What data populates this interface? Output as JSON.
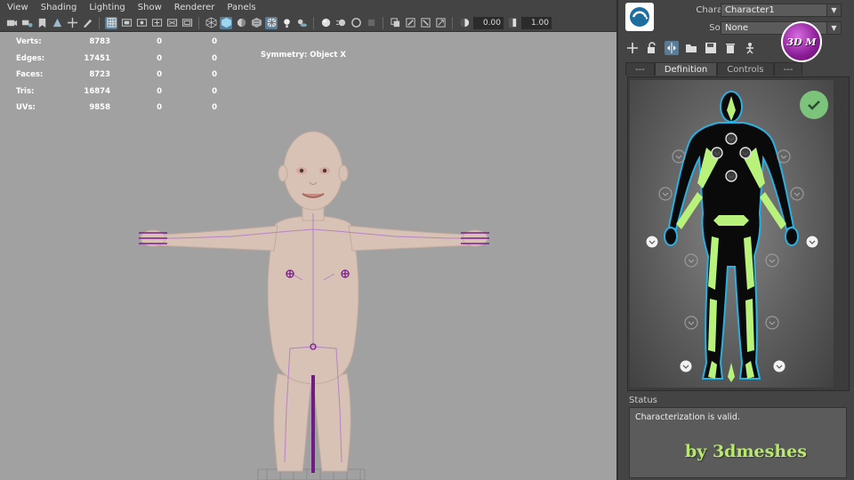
{
  "menubar": {
    "items": [
      "View",
      "Shading",
      "Lighting",
      "Show",
      "Renderer",
      "Panels"
    ]
  },
  "toolbar": {
    "value_a": "0.00",
    "value_b": "1.00",
    "icons": [
      "camera-icon",
      "camera-attr-icon",
      "bookmark-icon",
      "image-plane-icon",
      "grid-icon",
      "wireframe-icon",
      "smooth-shade-icon",
      "textured-icon",
      "lights-icon",
      "shadows-icon",
      "isolate-icon",
      "xray-icon",
      "xray-joints-icon",
      "resolution-gate-icon",
      "exposure-icon",
      "gamma-icon"
    ]
  },
  "hud": {
    "rows": [
      {
        "label": "Verts:",
        "v1": "8783",
        "v2": "0",
        "v3": "0"
      },
      {
        "label": "Edges:",
        "v1": "17451",
        "v2": "0",
        "v3": "0"
      },
      {
        "label": "Faces:",
        "v1": "8723",
        "v2": "0",
        "v3": "0"
      },
      {
        "label": "Tris:",
        "v1": "16874",
        "v2": "0",
        "v3": "0"
      },
      {
        "label": "UVs:",
        "v1": "9858",
        "v2": "0",
        "v3": "0"
      }
    ],
    "symmetry": "Symmetry: Object X"
  },
  "panel": {
    "character_label": "Character:",
    "character_value": "Character1",
    "source_label": "Source:",
    "source_value": "None",
    "tabs": [
      "---",
      "Definition",
      "Controls",
      "---"
    ],
    "active_tab": "Definition",
    "badge": "3D M",
    "status_label": "Status",
    "status_text": "Characterization is valid.",
    "watermark": "by 3dmeshes",
    "colors": {
      "bone_green": "#b9f27a",
      "body_black": "#0a0a0a",
      "outline_blue": "#2ab0e0",
      "valid_green": "#7cc47c"
    }
  }
}
